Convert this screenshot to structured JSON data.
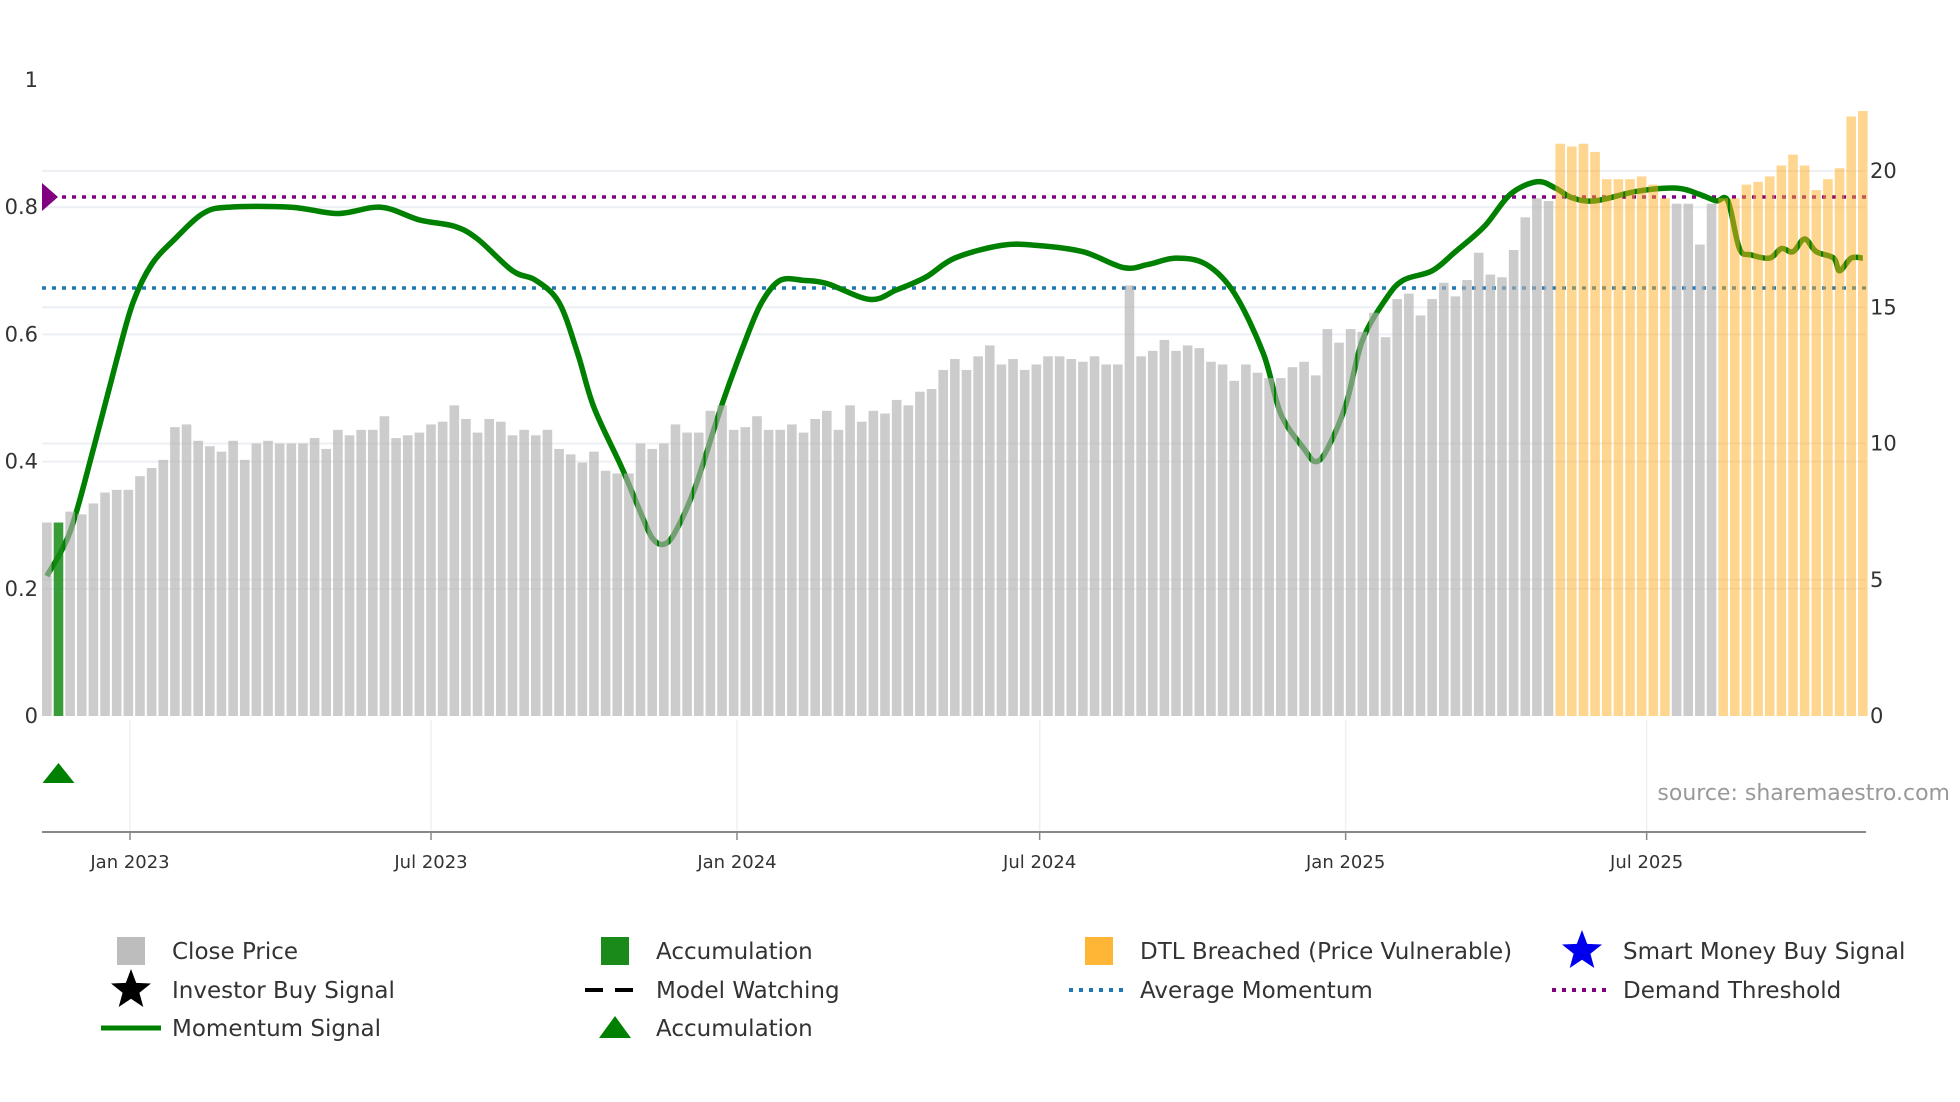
{
  "chart_data": {
    "type": "bar+line",
    "x_start": "2022-11-12",
    "interval_days": 7,
    "close_price": [
      7.1,
      7.1,
      7.5,
      7.4,
      7.8,
      8.2,
      8.3,
      8.3,
      8.8,
      9.1,
      9.4,
      10.6,
      10.7,
      10.1,
      9.9,
      9.7,
      10.1,
      9.4,
      10.0,
      10.1,
      10.0,
      10.0,
      10.0,
      10.2,
      9.8,
      10.5,
      10.3,
      10.5,
      10.5,
      11.0,
      10.2,
      10.3,
      10.4,
      10.7,
      10.8,
      11.4,
      10.9,
      10.4,
      10.9,
      10.8,
      10.3,
      10.5,
      10.3,
      10.5,
      9.8,
      9.6,
      9.3,
      9.7,
      9.0,
      8.9,
      8.9,
      10.0,
      9.8,
      10.0,
      10.7,
      10.4,
      10.4,
      11.2,
      11.4,
      10.5,
      10.6,
      11.0,
      10.5,
      10.5,
      10.7,
      10.4,
      10.9,
      11.2,
      10.5,
      11.4,
      10.8,
      11.2,
      11.1,
      11.6,
      11.4,
      11.9,
      12.0,
      12.7,
      13.1,
      12.7,
      13.2,
      13.6,
      12.9,
      13.1,
      12.7,
      12.9,
      13.2,
      13.2,
      13.1,
      13.0,
      13.2,
      12.9,
      12.9,
      15.8,
      13.2,
      13.4,
      13.8,
      13.4,
      13.6,
      13.5,
      13.0,
      12.9,
      12.3,
      12.9,
      12.6,
      12.4,
      12.4,
      12.8,
      13.0,
      12.5,
      14.2,
      13.7,
      14.2,
      14.1,
      14.8,
      13.9,
      15.3,
      15.5,
      14.7,
      15.3,
      15.9,
      15.4,
      16.0,
      17.0,
      16.2,
      16.1,
      17.1,
      18.3,
      19.0,
      18.9,
      21.0,
      20.9,
      21.0,
      20.7,
      19.7,
      19.7,
      19.7,
      19.8,
      19.5,
      19.0,
      18.8,
      18.8,
      17.3,
      18.8,
      19.0,
      19.0,
      19.5,
      19.6,
      19.8,
      20.2,
      20.6,
      20.2,
      19.3,
      19.7,
      20.1,
      22.0,
      22.2
    ],
    "accumulation_bar_indices": [
      1
    ],
    "dtl_breached_ranges": [
      [
        130,
        139
      ],
      [
        144,
        156
      ]
    ],
    "momentum_signal": [
      [
        1,
        0.22
      ],
      [
        3,
        0.29
      ],
      [
        5,
        0.42
      ],
      [
        7,
        0.56
      ],
      [
        8.4,
        0.65
      ],
      [
        10,
        0.71
      ],
      [
        12,
        0.75
      ],
      [
        14.4,
        0.79
      ],
      [
        16.6,
        0.8
      ],
      [
        22,
        0.8
      ],
      [
        26,
        0.79
      ],
      [
        29.7,
        0.8
      ],
      [
        33,
        0.78
      ],
      [
        36,
        0.77
      ],
      [
        38,
        0.75
      ],
      [
        41,
        0.7
      ],
      [
        43,
        0.685
      ],
      [
        45,
        0.65
      ],
      [
        46.6,
        0.57
      ],
      [
        48,
        0.485
      ],
      [
        50.4,
        0.39
      ],
      [
        52,
        0.32
      ],
      [
        53,
        0.28
      ],
      [
        54,
        0.27
      ],
      [
        55,
        0.29
      ],
      [
        56.7,
        0.36
      ],
      [
        59,
        0.49
      ],
      [
        61,
        0.59
      ],
      [
        62.4,
        0.65
      ],
      [
        64,
        0.685
      ],
      [
        66,
        0.685
      ],
      [
        68,
        0.68
      ],
      [
        71.7,
        0.655
      ],
      [
        74,
        0.67
      ],
      [
        76.5,
        0.69
      ],
      [
        79,
        0.72
      ],
      [
        83,
        0.74
      ],
      [
        86,
        0.74
      ],
      [
        90,
        0.73
      ],
      [
        93.5,
        0.705
      ],
      [
        95.6,
        0.71
      ],
      [
        98,
        0.72
      ],
      [
        100.6,
        0.71
      ],
      [
        103,
        0.665
      ],
      [
        105.5,
        0.57
      ],
      [
        107,
        0.475
      ],
      [
        109,
        0.42
      ],
      [
        110,
        0.4
      ],
      [
        111,
        0.42
      ],
      [
        112.6,
        0.49
      ],
      [
        114,
        0.59
      ],
      [
        116,
        0.655
      ],
      [
        117.5,
        0.685
      ],
      [
        120,
        0.7
      ],
      [
        122,
        0.73
      ],
      [
        124.5,
        0.77
      ],
      [
        126.7,
        0.82
      ],
      [
        129,
        0.84
      ],
      [
        130.6,
        0.83
      ],
      [
        132,
        0.815
      ],
      [
        134,
        0.81
      ],
      [
        137.6,
        0.825
      ],
      [
        141,
        0.83
      ],
      [
        143,
        0.82
      ],
      [
        144.4,
        0.81
      ],
      [
        145.4,
        0.81
      ],
      [
        146.4,
        0.735
      ],
      [
        147.4,
        0.725
      ],
      [
        149,
        0.72
      ],
      [
        150,
        0.735
      ],
      [
        151,
        0.73
      ],
      [
        152,
        0.75
      ],
      [
        153,
        0.73
      ],
      [
        154.5,
        0.72
      ],
      [
        155,
        0.7
      ],
      [
        156,
        0.72
      ],
      [
        157,
        0.72
      ]
    ],
    "average_momentum": 0.673,
    "demand_threshold": 0.816,
    "accumulation_marker_index": 1,
    "left_axis": {
      "range": [
        0,
        1
      ],
      "ticks": [
        "0",
        "0.2",
        "0.4",
        "0.6",
        "0.8",
        "1"
      ]
    },
    "right_axis": {
      "range": [
        0,
        23.3
      ],
      "ticks": [
        "0",
        "5",
        "10",
        "15",
        "20"
      ]
    },
    "x_ticks": [
      {
        "label": "Jan 2023",
        "date": "2023-01-01"
      },
      {
        "label": "Jul 2023",
        "date": "2023-07-01"
      },
      {
        "label": "Jan 2024",
        "date": "2024-01-01"
      },
      {
        "label": "Jul 2024",
        "date": "2024-07-01"
      },
      {
        "label": "Jan 2025",
        "date": "2025-01-01"
      },
      {
        "label": "Jul 2025",
        "date": "2025-07-01"
      }
    ],
    "source": "source: sharemaestro.com",
    "legend": [
      {
        "label": "Close Price",
        "marker": "square",
        "color": "#bdbdbd"
      },
      {
        "label": "Accumulation",
        "marker": "square",
        "color": "#1a8a1a"
      },
      {
        "label": "DTL Breached (Price Vulnerable)",
        "marker": "square",
        "color": "#ffad20"
      },
      {
        "label": "Smart Money Buy Signal",
        "marker": "star",
        "color": "#0000ee"
      },
      {
        "label": "Investor Buy Signal",
        "marker": "star",
        "color": "#000000"
      },
      {
        "label": "Model Watching",
        "marker": "dash",
        "color": "#000000"
      },
      {
        "label": "Average Momentum",
        "marker": "dot",
        "color": "#1f77b4"
      },
      {
        "label": "Demand Threshold",
        "marker": "dot",
        "color": "#800080"
      },
      {
        "label": "Momentum Signal",
        "marker": "line",
        "color": "#008000"
      },
      {
        "label": "Accumulation",
        "marker": "triangle",
        "color": "#008000"
      }
    ],
    "legend_placement": "bottom",
    "colors": {
      "price": "#b0b0b0",
      "accum": "#158c15",
      "dtl": "#ffad20",
      "momentum": "#008000",
      "avg": "#1f77b4",
      "threshold": "#800080"
    }
  }
}
